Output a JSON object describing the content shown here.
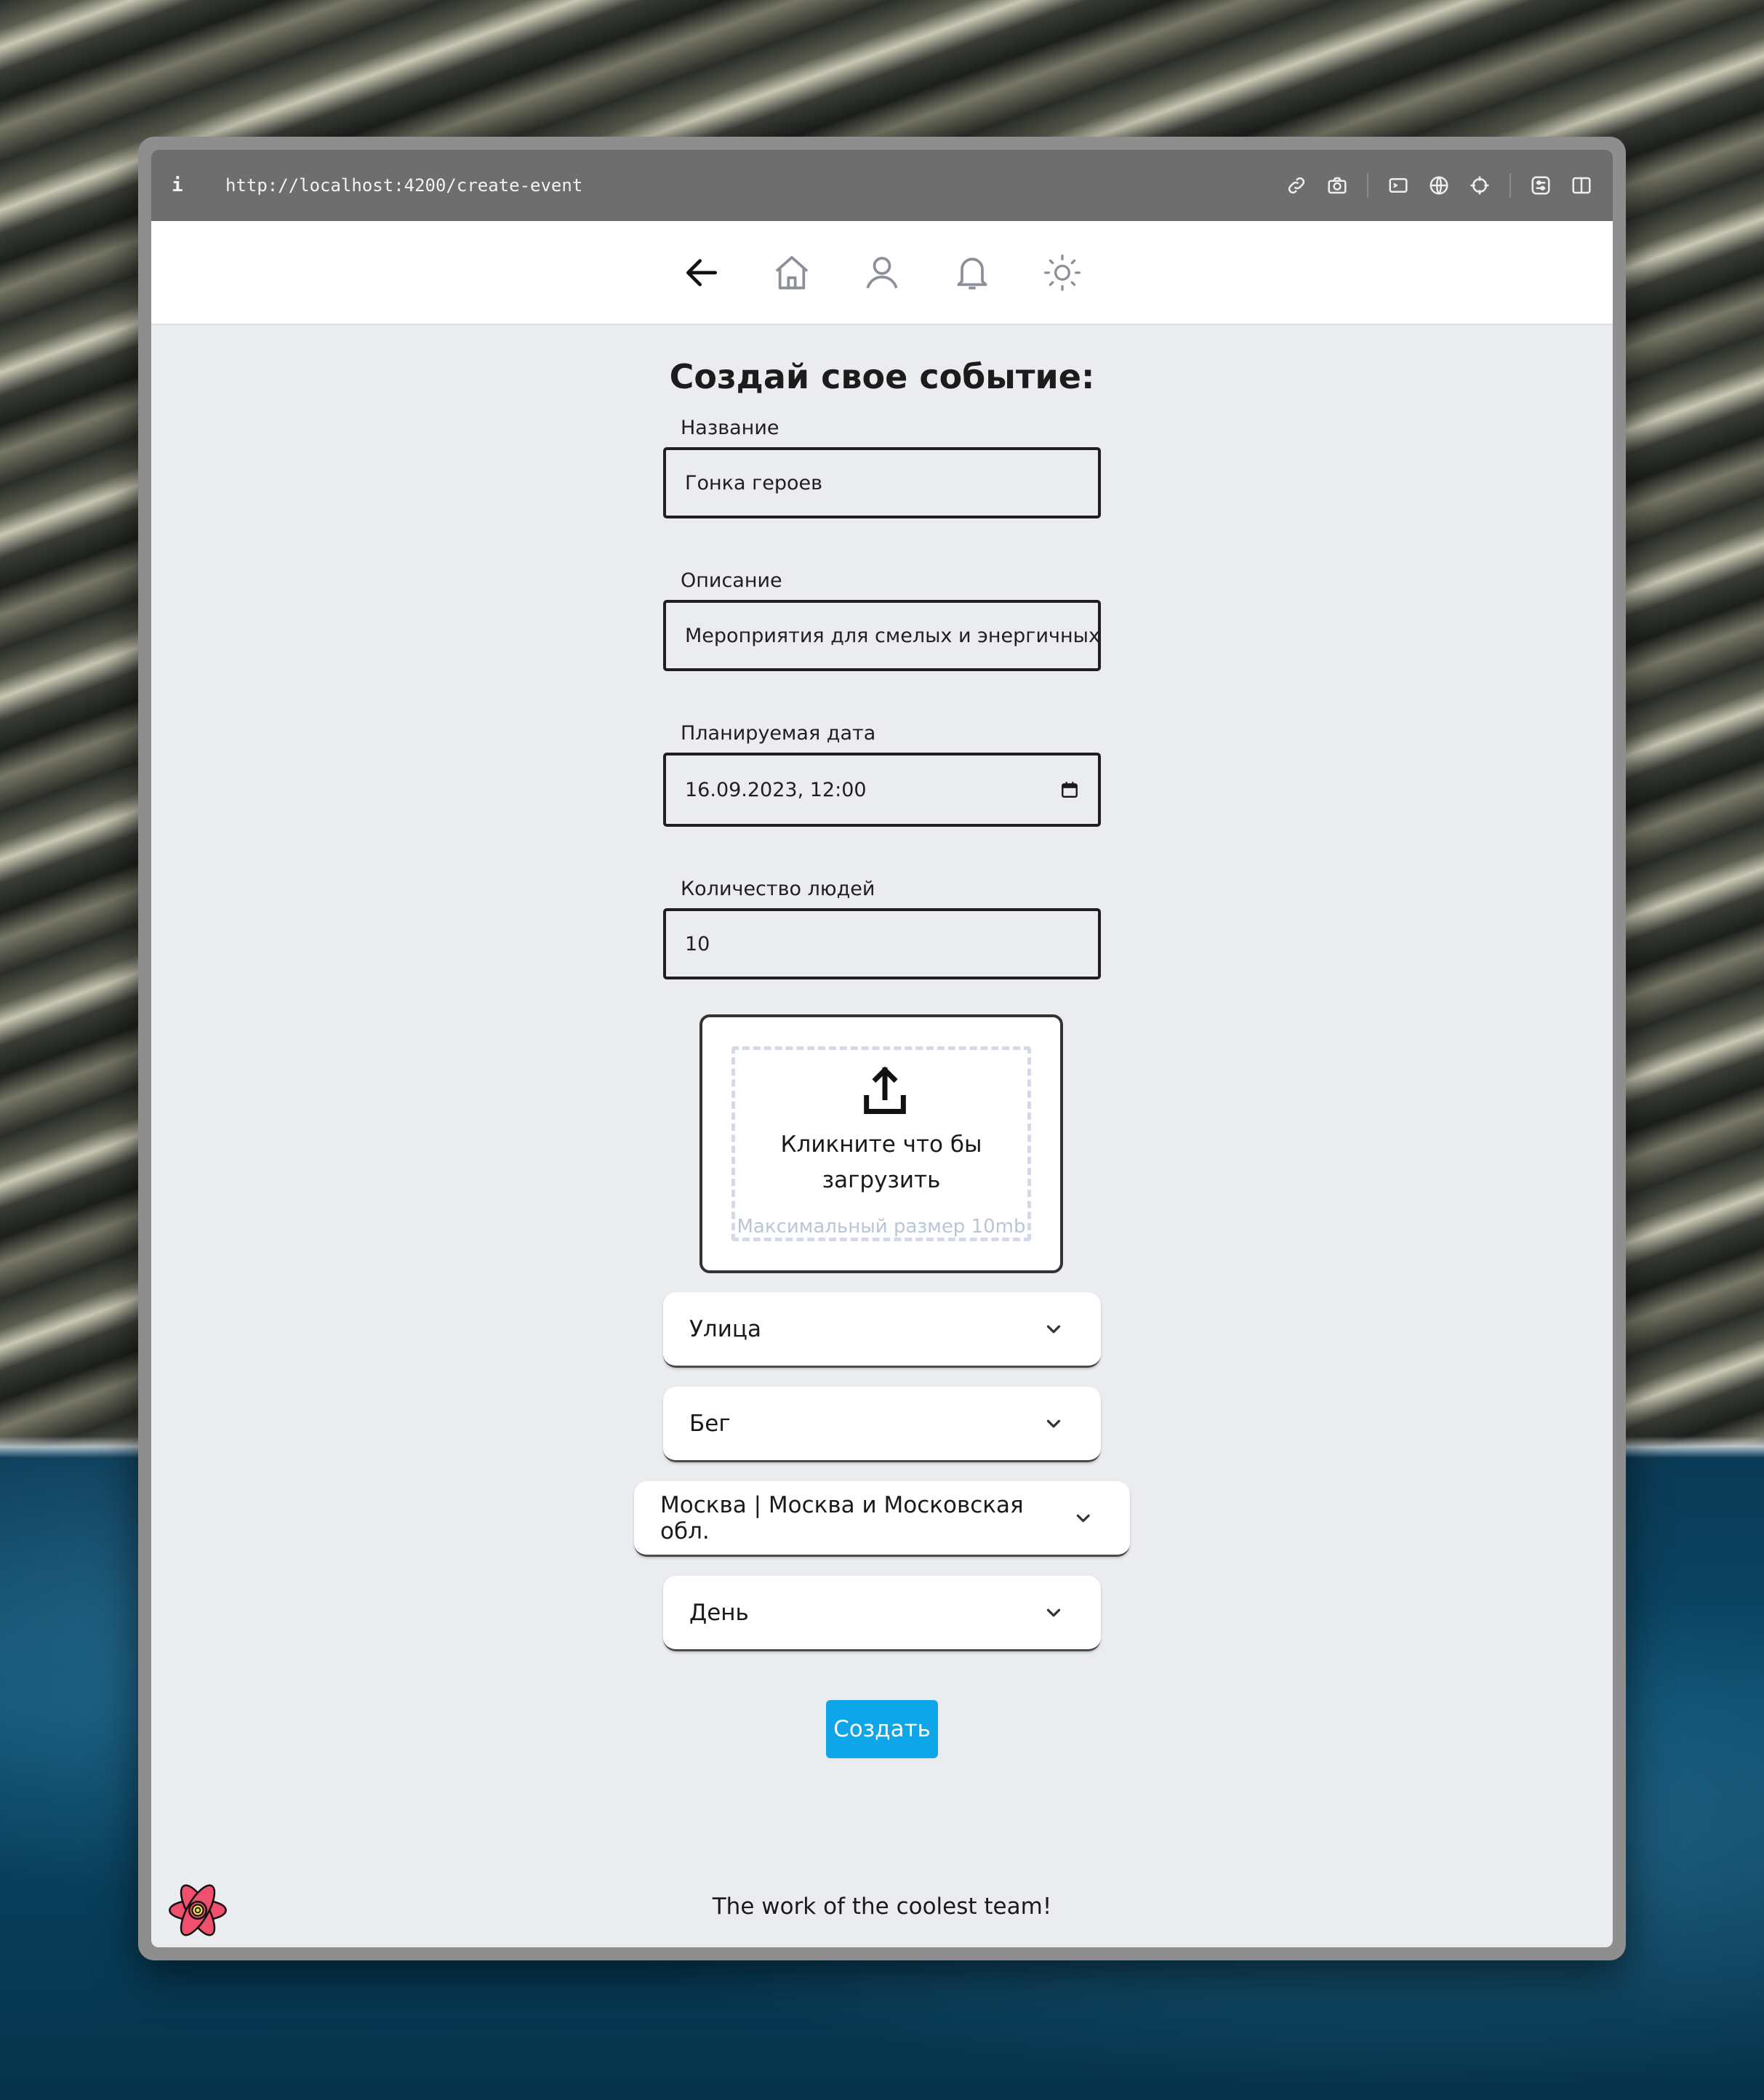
{
  "browser": {
    "info_label": "i",
    "url": "http://localhost:4200/create-event",
    "tools": [
      "link-icon",
      "camera-icon",
      "terminal-icon",
      "globe-icon",
      "crosshair-icon",
      "sliders-icon",
      "split-view-icon"
    ]
  },
  "nav": {
    "icons": [
      "back-arrow-icon",
      "home-icon",
      "user-icon",
      "bell-icon",
      "sun-icon"
    ]
  },
  "page": {
    "title": "Создай свое событие:"
  },
  "form": {
    "name": {
      "label": "Название",
      "value": "Гонка героев"
    },
    "description": {
      "label": "Описание",
      "value": "Мероприятия для смелых и энергичных,"
    },
    "date": {
      "label": "Планируемая дата",
      "value": "16.09.2023, 12:00"
    },
    "people": {
      "label": "Количество людей",
      "value": "10"
    },
    "upload": {
      "text": "Кликните что бы загрузить",
      "hint": "Максимальный размер 10mb"
    },
    "selects": {
      "place": "Улица",
      "category": "Бег",
      "city": "Москва | Москва и Московская обл.",
      "time": "День"
    },
    "submit_label": "Создать"
  },
  "footer": {
    "text": "The work of the coolest team!"
  },
  "colors": {
    "accent": "#0ea5e9",
    "background": "#ebecef",
    "logo": "#f0506e"
  }
}
